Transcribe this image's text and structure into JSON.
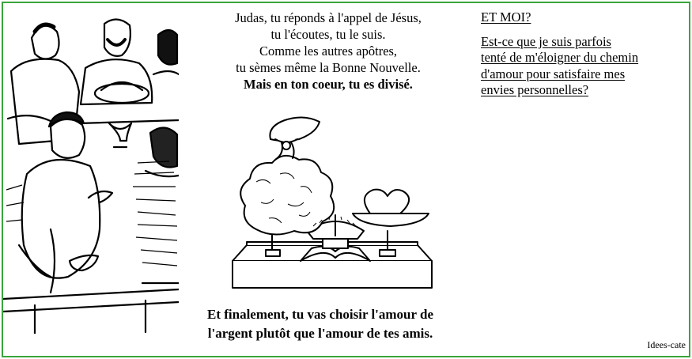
{
  "passage": {
    "lines": [
      "Judas, tu réponds à l'appel de Jésus,",
      "tu l'écoutes, tu le suis.",
      "Comme les autres apôtres,",
      "tu sèmes même la Bonne Nouvelle."
    ],
    "emphasis": "Mais en ton coeur, tu es divisé."
  },
  "conclusion": {
    "lines": [
      "Et finalement, tu vas choisir l'amour de",
      "l'argent plutôt que l'amour de tes amis."
    ]
  },
  "reflection": {
    "title": "ET MOI?",
    "question_lines": [
      "Est-ce que je suis parfois",
      "tenté de m'éloigner du chemin",
      "d'amour pour satisfaire mes",
      "envies personnelles?"
    ]
  },
  "credit": "Idees-cate",
  "colors": {
    "frame_border": "#3aa53a",
    "ink": "#000000"
  },
  "illustrations": {
    "left": "last-supper-apostles-drawing",
    "center": "scale-money-bag-versus-heart-drawing"
  }
}
